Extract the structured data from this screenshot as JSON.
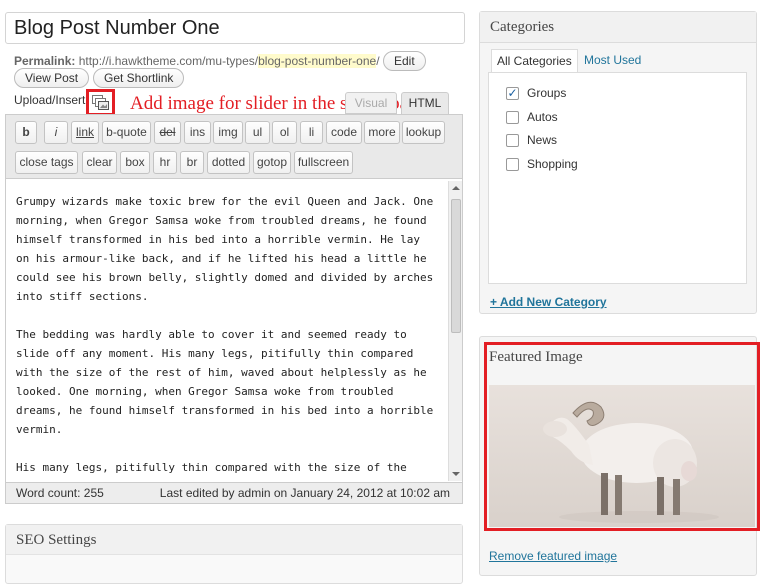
{
  "post": {
    "title": "Blog Post Number One",
    "permalink_label": "Permalink:",
    "permalink_base": "http://i.hawktheme.com/mu-types/",
    "permalink_slug": "blog-post-number-one",
    "permalink_trail": "/",
    "edit_label": "Edit",
    "view_post_label": "View Post",
    "get_shortlink_label": "Get Shortlink"
  },
  "media": {
    "upload_insert_label": "Upload/Insert",
    "icon": "add-media-icon"
  },
  "annotation": {
    "text": "Add image for slider in the single page",
    "color": "#e31e24"
  },
  "editor_tabs": {
    "visual": "Visual",
    "html": "HTML"
  },
  "quicktags": {
    "row1": [
      "b",
      "i",
      "link",
      "b-quote",
      "del",
      "ins",
      "img",
      "ul",
      "ol",
      "li",
      "code",
      "more",
      "lookup"
    ],
    "row2": [
      "close tags",
      "clear",
      "box",
      "hr",
      "br",
      "dotted",
      "gotop",
      "fullscreen"
    ]
  },
  "content": {
    "paragraphs": [
      "Grumpy wizards make toxic brew for the evil Queen and Jack. One morning, when Gregor Samsa woke from troubled dreams, he found himself transformed in his bed into a horrible vermin. He lay on his armour-like back, and if he lifted his head a little he could see his brown belly, slightly domed and divided by arches into stiff sections.",
      "The bedding was hardly able to cover it and seemed ready to slide off any moment. His many legs, pitifully thin compared with the size of the rest of him, waved about helplessly as he looked. One morning, when Gregor Samsa woke from troubled dreams, he found himself transformed in his bed into a horrible vermin.",
      "His many legs, pitifully thin compared with the size of the"
    ]
  },
  "status": {
    "word_count": "Word count: 255",
    "last_edited": "Last edited by admin on January 24, 2012 at 10:02 am"
  },
  "seo": {
    "title": "SEO Settings"
  },
  "categories": {
    "title": "Categories",
    "tab_all": "All Categories",
    "tab_most_used": "Most Used",
    "items": [
      {
        "label": "Groups",
        "checked": true
      },
      {
        "label": "Autos",
        "checked": false
      },
      {
        "label": "News",
        "checked": false
      },
      {
        "label": "Shopping",
        "checked": false
      }
    ],
    "add_new": "+ Add New Category"
  },
  "featured": {
    "title": "Featured Image",
    "remove_label": "Remove featured image",
    "image_subject": "white ram photo"
  },
  "colors": {
    "highlight_red": "#e31e24",
    "link_blue": "#21759b",
    "slug_highlight": "#fffbcc"
  }
}
